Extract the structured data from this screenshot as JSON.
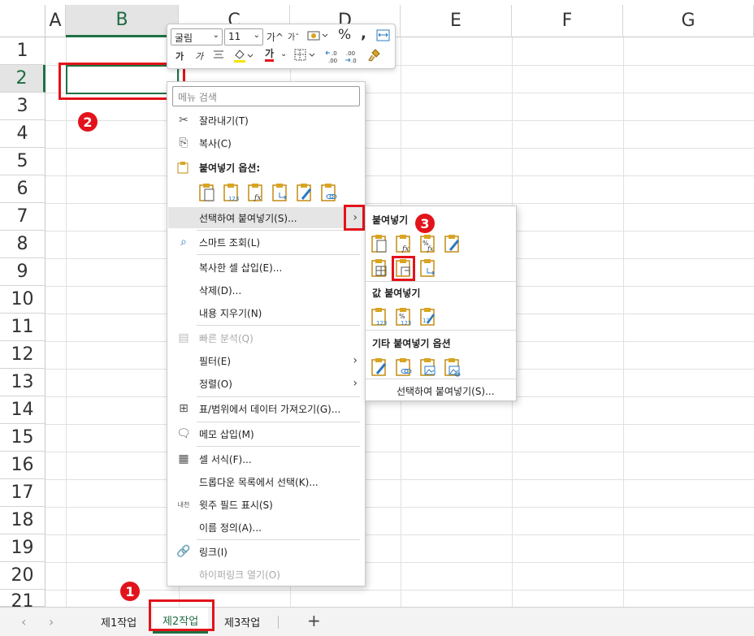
{
  "columns": [
    "A",
    "B",
    "C",
    "D",
    "E",
    "F",
    "G"
  ],
  "rows": [
    "1",
    "2",
    "3",
    "4",
    "5",
    "6",
    "7",
    "8",
    "9",
    "10",
    "11",
    "12",
    "13",
    "14",
    "15",
    "16",
    "17",
    "18",
    "19",
    "20",
    "21"
  ],
  "selected_cell": "B2",
  "mini_toolbar": {
    "font_name": "굴림",
    "font_size": "11",
    "increase_font": "가^",
    "decrease_font": "가ˇ",
    "percent": "%",
    "comma": ",",
    "bold": "가",
    "italic": "가",
    "font_color_sample": "가",
    "dec_increase": "←.0\n.00",
    "dec_decrease": ".00\n→.0"
  },
  "context_menu": {
    "search_placeholder": "메뉴 검색",
    "items": {
      "cut": "잘라내기(T)",
      "copy": "복사(C)",
      "paste_options": "붙여넣기 옵션:",
      "paste_special": "선택하여 붙여넣기(S)...",
      "smart_lookup": "스마트 조회(L)",
      "insert_copied": "복사한 셀 삽입(E)...",
      "delete": "삭제(D)...",
      "clear_contents": "내용 지우기(N)",
      "quick_analysis": "빠른 분석(Q)",
      "filter": "필터(E)",
      "sort": "정렬(O)",
      "get_data": "표/범위에서 데이터 가져오기(G)...",
      "insert_comment": "메모 삽입(M)",
      "format_cells": "셀 서식(F)...",
      "dropdown": "드롭다운 목록에서 선택(K)...",
      "phonetic": "윗주 필드 표시(S)",
      "define_name": "이름 정의(A)...",
      "link": "링크(I)",
      "open_hyperlink": "하이퍼링크 열기(O)"
    },
    "phonetic_icon_text": "내천"
  },
  "submenu": {
    "paste_header": "붙여넣기",
    "values_header": "값 붙여넣기",
    "other_header": "기타 붙여넣기 옵션",
    "paste_special_link": "선택하여 붙여넣기(S)..."
  },
  "badges": [
    "1",
    "2",
    "3"
  ],
  "sheet_tabs": [
    "제1작업",
    "제2작업",
    "제3작업"
  ],
  "active_tab": "제2작업",
  "add_tab": "+",
  "colors": {
    "accent_green": "#1e7145",
    "highlight_red": "#e3131b",
    "gold_clipboard": "#d9a521",
    "blue_arrow": "#2b79c2"
  }
}
